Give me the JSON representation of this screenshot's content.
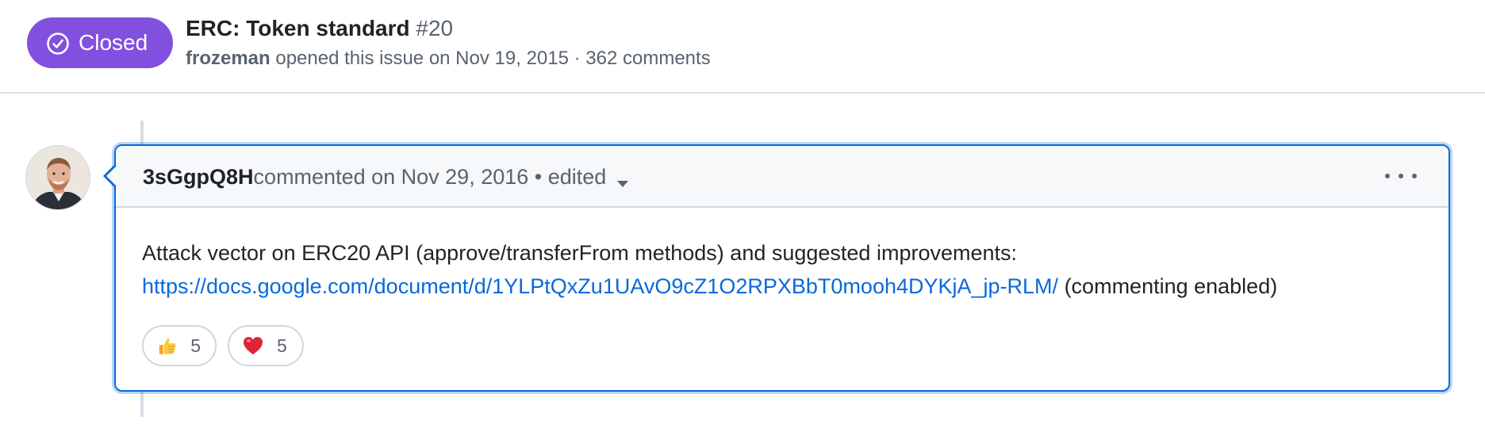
{
  "issue": {
    "state": "Closed",
    "title": "ERC: Token standard",
    "number": "#20",
    "author": "frozeman",
    "meta_text": " opened this issue on Nov 19, 2015 · 362 comments",
    "state_color": "#8250df"
  },
  "comment": {
    "author": "3sGgpQ8H",
    "meta_text": " commented on Nov 29, 2016 • edited",
    "body_line1": "Attack vector on ERC20 API (approve/transferFrom methods) and suggested improvements:",
    "link_text": "https://docs.google.com/document/d/1YLPtQxZu1UAvO9cZ1O2RPXBbT0mooh4DYKjA_jp-RLM/",
    "after_link_text": " (commenting enabled)",
    "accent_color": "#0969da",
    "reactions": [
      {
        "icon": "thumbs-up-icon",
        "count": "5"
      },
      {
        "icon": "heart-icon",
        "count": "5"
      }
    ]
  }
}
